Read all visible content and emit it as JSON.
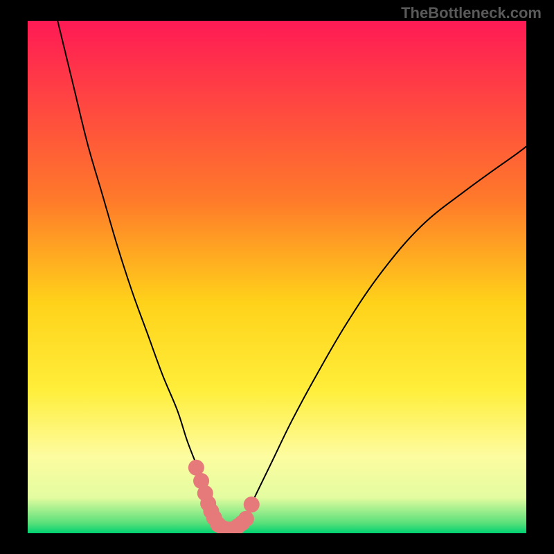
{
  "watermark": "TheBottleneck.com",
  "chart_data": {
    "type": "line",
    "title": "",
    "xlabel": "",
    "ylabel": "",
    "xlim": [
      0,
      100
    ],
    "ylim": [
      0,
      100
    ],
    "gradient_stops": [
      {
        "offset": 0,
        "color": "#ff1a55"
      },
      {
        "offset": 35,
        "color": "#ff7a2a"
      },
      {
        "offset": 55,
        "color": "#ffd21a"
      },
      {
        "offset": 72,
        "color": "#ffee3a"
      },
      {
        "offset": 85,
        "color": "#fdfca0"
      },
      {
        "offset": 93,
        "color": "#e4fca0"
      },
      {
        "offset": 98,
        "color": "#5ae07a"
      },
      {
        "offset": 100,
        "color": "#00d272"
      }
    ],
    "series": [
      {
        "name": "curve-left",
        "x": [
          6,
          9,
          12,
          15,
          18,
          21,
          24,
          27,
          30,
          32,
          34,
          36,
          37.5,
          38.5
        ],
        "y": [
          100,
          88,
          76,
          66,
          56,
          47,
          39,
          31,
          24,
          18,
          13,
          8,
          4,
          0.5
        ]
      },
      {
        "name": "curve-right",
        "x": [
          42,
          43.5,
          46,
          49,
          53,
          58,
          64,
          71,
          79,
          88,
          98,
          100
        ],
        "y": [
          0.5,
          3,
          8,
          14,
          22,
          31,
          41,
          51,
          60,
          67,
          74,
          75.5
        ]
      }
    ],
    "markers": [
      {
        "x": 33.8,
        "y": 12.8,
        "r": 1.6
      },
      {
        "x": 34.8,
        "y": 10.2,
        "r": 1.6
      },
      {
        "x": 35.6,
        "y": 7.8,
        "r": 1.6
      },
      {
        "x": 36.2,
        "y": 5.8,
        "r": 1.6
      },
      {
        "x": 36.8,
        "y": 4.3,
        "r": 1.6
      },
      {
        "x": 37.4,
        "y": 3.0,
        "r": 1.6
      },
      {
        "x": 38.2,
        "y": 1.7,
        "r": 1.6
      },
      {
        "x": 39.2,
        "y": 1.0,
        "r": 1.6
      },
      {
        "x": 40.5,
        "y": 0.7,
        "r": 1.6
      },
      {
        "x": 41.4,
        "y": 0.9,
        "r": 1.6
      },
      {
        "x": 42.2,
        "y": 1.4,
        "r": 1.6
      },
      {
        "x": 43.0,
        "y": 2.0,
        "r": 1.6
      },
      {
        "x": 43.8,
        "y": 2.8,
        "r": 1.6
      },
      {
        "x": 44.9,
        "y": 5.6,
        "r": 1.6
      }
    ],
    "marker_color": "#e67a7a",
    "curve_color": "#000000",
    "curve_width": 2
  }
}
